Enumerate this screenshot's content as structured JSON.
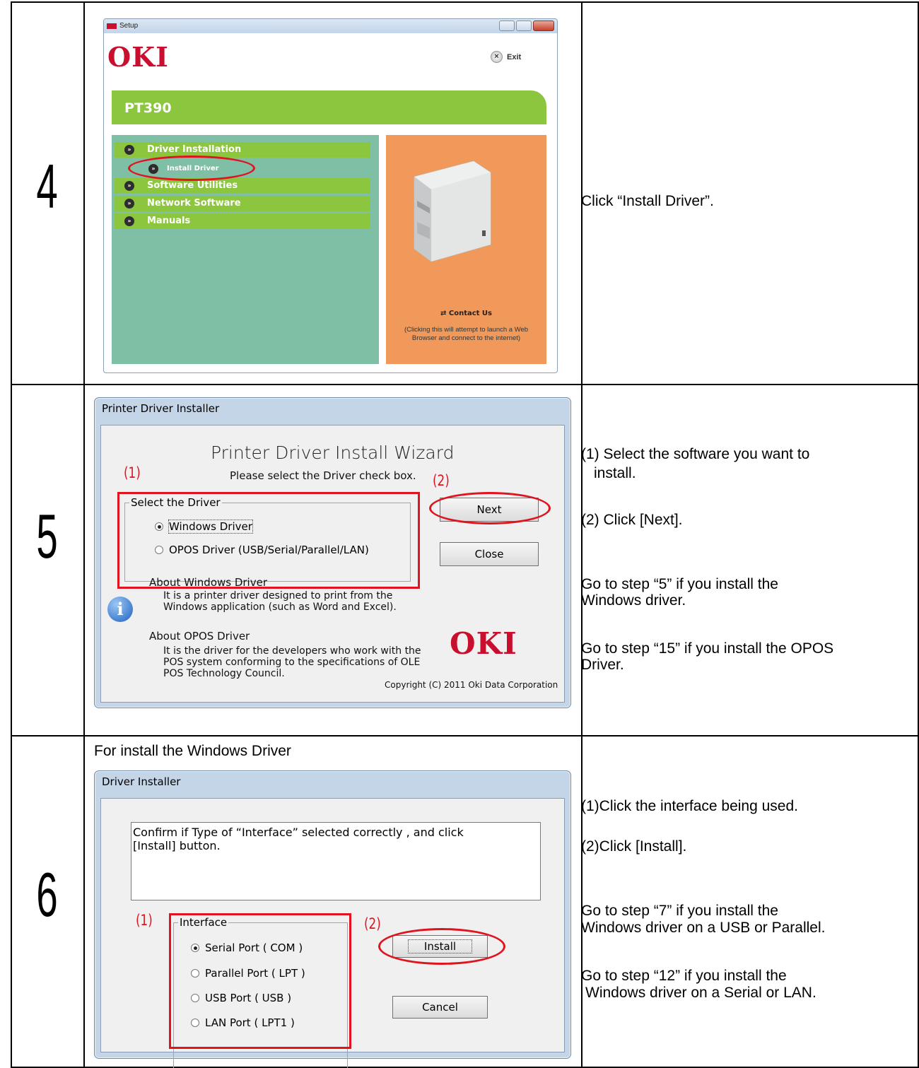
{
  "steps": [
    {
      "number": "4",
      "description": [
        "Click “Install Driver”."
      ]
    },
    {
      "number": "5",
      "description": [
        "(1) Select the software you want to",
        "install.",
        "(2) Click [Next].",
        "Go to step “5” if you install the",
        "Windows driver.",
        "Go to step “15” if you install the OPOS",
        "Driver."
      ]
    },
    {
      "number": "6",
      "heading": "For install the Windows Driver",
      "description": [
        "(1)Click the interface being used.",
        "(2)Click [Install].",
        "Go to step “7” if you install the",
        "Windows driver on a USB or Parallel.",
        "Go to step “12” if you install the",
        "Windows driver on a Serial or LAN."
      ]
    }
  ],
  "setup_window": {
    "title": "Setup",
    "logo": "OKI",
    "exit_label": "Exit",
    "product": "PT390",
    "menu": [
      "Driver Installation",
      "Software Utilities",
      "Network Software",
      "Manuals"
    ],
    "submenu": "Install Driver",
    "contact_label": "Contact Us",
    "contact_note": [
      "(Clicking this will attempt to launch a Web",
      "Browser and connect to the internet)"
    ],
    "accent_green": "#8cc63f",
    "accent_orange": "#f0995a"
  },
  "installer_dialog": {
    "title": "Printer Driver Installer",
    "heading": "Printer Driver Install Wizard",
    "instruction": "Please select the Driver check box.",
    "group_label": "Select the Driver",
    "options": [
      "Windows Driver",
      "OPOS Driver (USB/Serial/Parallel/LAN)"
    ],
    "selected": 0,
    "next_label": "Next",
    "close_label": "Close",
    "about_windows_title": "About Windows Driver",
    "about_windows_text": [
      "It is a printer driver designed to print from the",
      "Windows application (such as Word and Excel)."
    ],
    "about_opos_title": "About OPOS Driver",
    "about_opos_text": [
      "It is the driver for the developers who work with the",
      "POS system conforming to the specifications of OLE",
      "POS Technology Council."
    ],
    "logo": "OKI",
    "copyright": "Copyright (C) 2011 Oki Data Corporation",
    "marker1": "(1)",
    "marker2": "(2)"
  },
  "driver_dialog": {
    "title": "Driver Installer",
    "message": [
      "Confirm if Type of “Interface” selected correctly , and click",
      "[Install] button."
    ],
    "group_label": "Interface",
    "options": [
      "Serial Port ( COM )",
      "Parallel Port ( LPT )",
      "USB Port ( USB )",
      "LAN Port ( LPT1 )"
    ],
    "selected": 0,
    "install_label": "Install",
    "cancel_label": "Cancel",
    "marker1": "(1)",
    "marker2": "(2)"
  }
}
